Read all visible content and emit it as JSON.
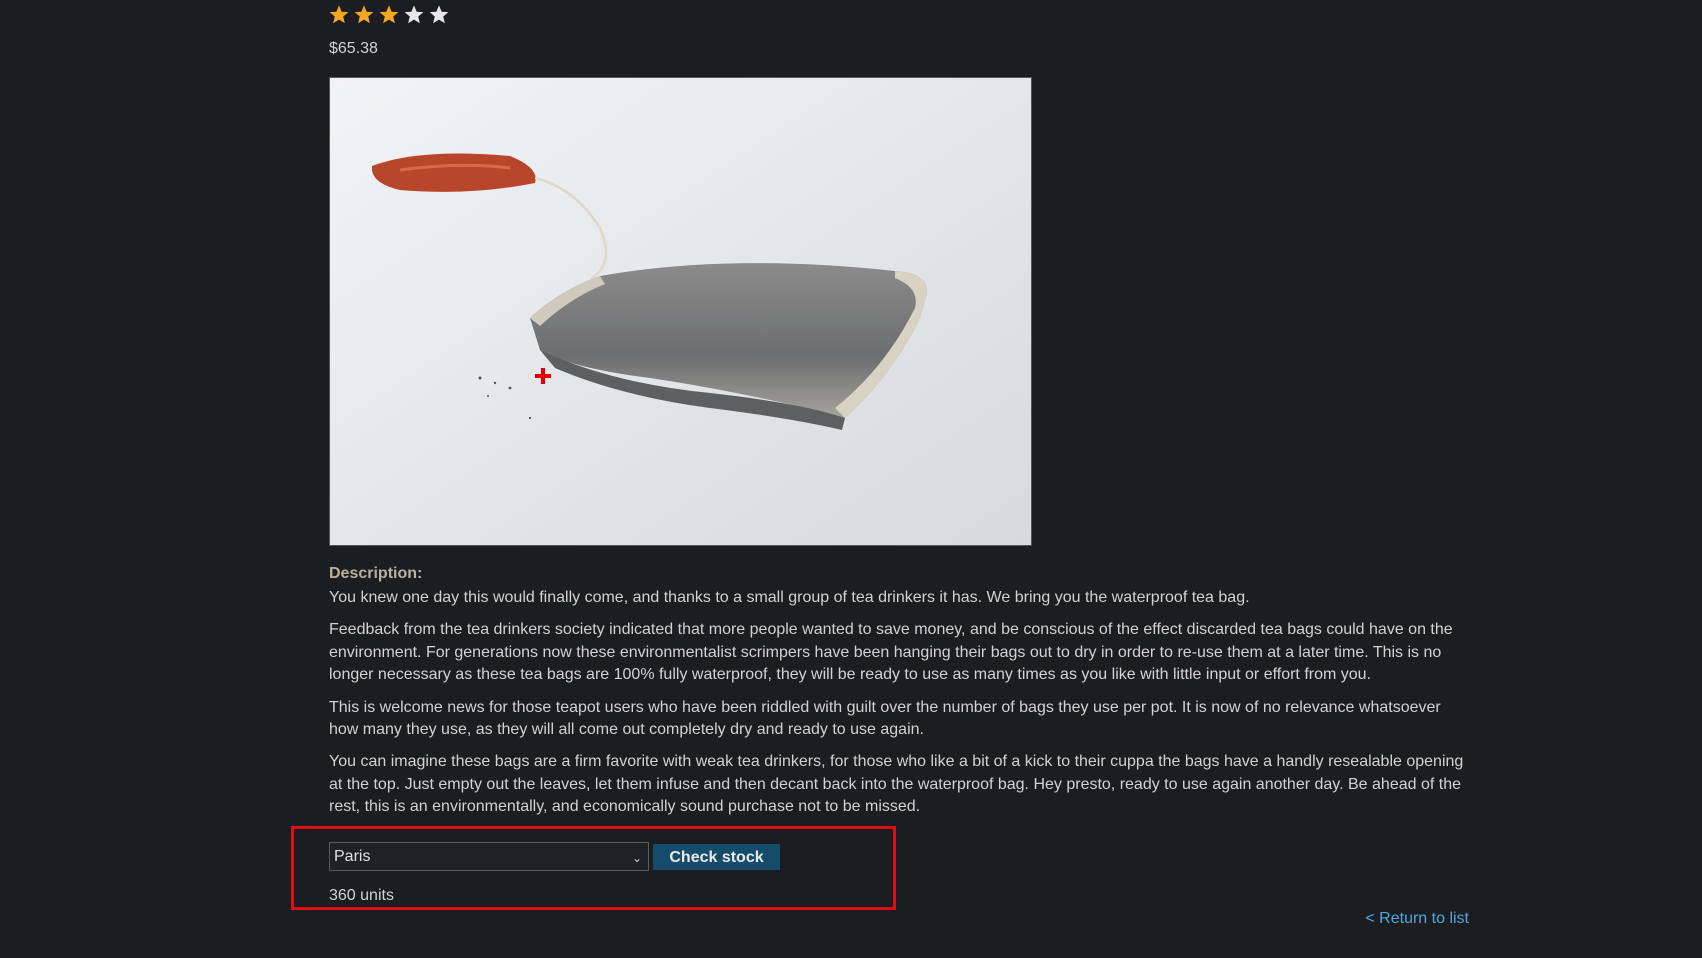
{
  "product": {
    "rating": 3,
    "rating_max": 5,
    "price": "$65.38",
    "image_icon": "tea-bag-photo"
  },
  "description": {
    "label": "Description:",
    "paragraphs": [
      "You knew one day this would finally come, and thanks to a small group of tea drinkers it has. We bring you the waterproof tea bag.",
      "Feedback from the tea drinkers society indicated that more people wanted to save money, and be conscious of the effect discarded tea bags could have on the environment. For generations now these environmentalist scrimpers have been hanging their bags out to dry in order to re-use them at a later time. This is no longer necessary as these tea bags are 100% fully waterproof, they will be ready to use as many times as you like with little input or effort from you.",
      "This is welcome news for those teapot users who have been riddled with guilt over the number of bags they use per pot. It is now of no relevance whatsoever how many they use, as they will all come out completely dry and ready to use again.",
      "You can imagine these bags are a firm favorite with weak tea drinkers, for those who like a bit of a kick to their cuppa the bags have a handly resealable opening at the top. Just empty out the leaves, let them infuse and then decant back into the waterproof bag. Hey presto, ready to use again another day. Be ahead of the rest, this is an environmentally, and economically sound purchase not to be missed."
    ]
  },
  "stock": {
    "selected_store": "Paris",
    "check_label": "Check stock",
    "result": "360 units"
  },
  "nav": {
    "return_label": "< Return to list"
  },
  "colors": {
    "star_filled": "#f5a623",
    "star_empty": "#e6e6e6",
    "button_bg": "#154b6b",
    "link": "#4ea8dd",
    "highlight": "#e01010"
  }
}
